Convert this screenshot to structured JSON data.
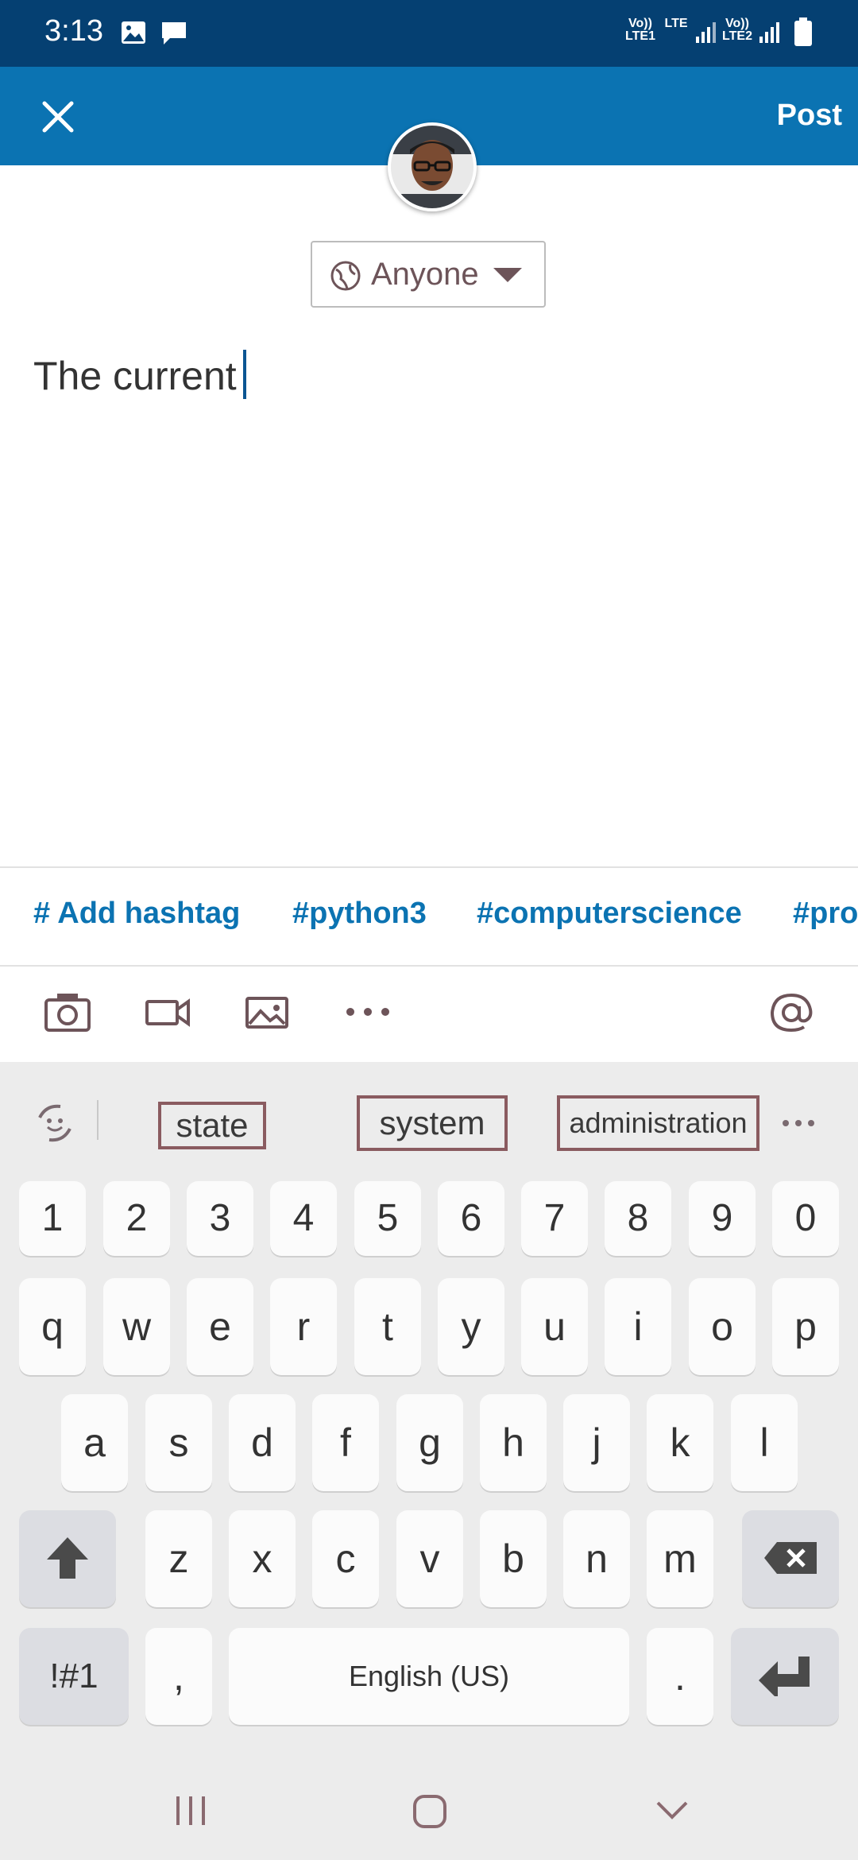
{
  "status_bar": {
    "time": "3:13",
    "icons": [
      "image-icon",
      "message-icon",
      "lte-signal-icon",
      "battery-icon"
    ],
    "sim1_label": "Vo)) LTE1",
    "lte_label": "LTE",
    "sim2_label": "Vo)) LTE2"
  },
  "app_bar": {
    "close_icon": "close-icon",
    "post_label": "Post",
    "bg_color": "#0b73b2"
  },
  "visibility": {
    "label": "Anyone",
    "icon": "globe-icon"
  },
  "composer": {
    "text": "The current"
  },
  "hashtags": [
    "# Add hashtag",
    "#python3",
    "#computerscience",
    "#pro"
  ],
  "attachment_toolbar": [
    "camera-icon",
    "video-icon",
    "image-icon",
    "more-icon",
    "mention-icon"
  ],
  "keyboard": {
    "suggestions": [
      "state",
      "system",
      "administration"
    ],
    "number_row": [
      "1",
      "2",
      "3",
      "4",
      "5",
      "6",
      "7",
      "8",
      "9",
      "0"
    ],
    "row1": [
      "q",
      "w",
      "e",
      "r",
      "t",
      "y",
      "u",
      "i",
      "o",
      "p"
    ],
    "row2": [
      "a",
      "s",
      "d",
      "f",
      "g",
      "h",
      "j",
      "k",
      "l"
    ],
    "row3": [
      "z",
      "x",
      "c",
      "v",
      "b",
      "n",
      "m"
    ],
    "symbols_label": "!#1",
    "comma_label": ",",
    "space_label": "English (US)",
    "period_label": "."
  },
  "nav_bar": [
    "recents-icon",
    "home-icon",
    "back-icon"
  ]
}
